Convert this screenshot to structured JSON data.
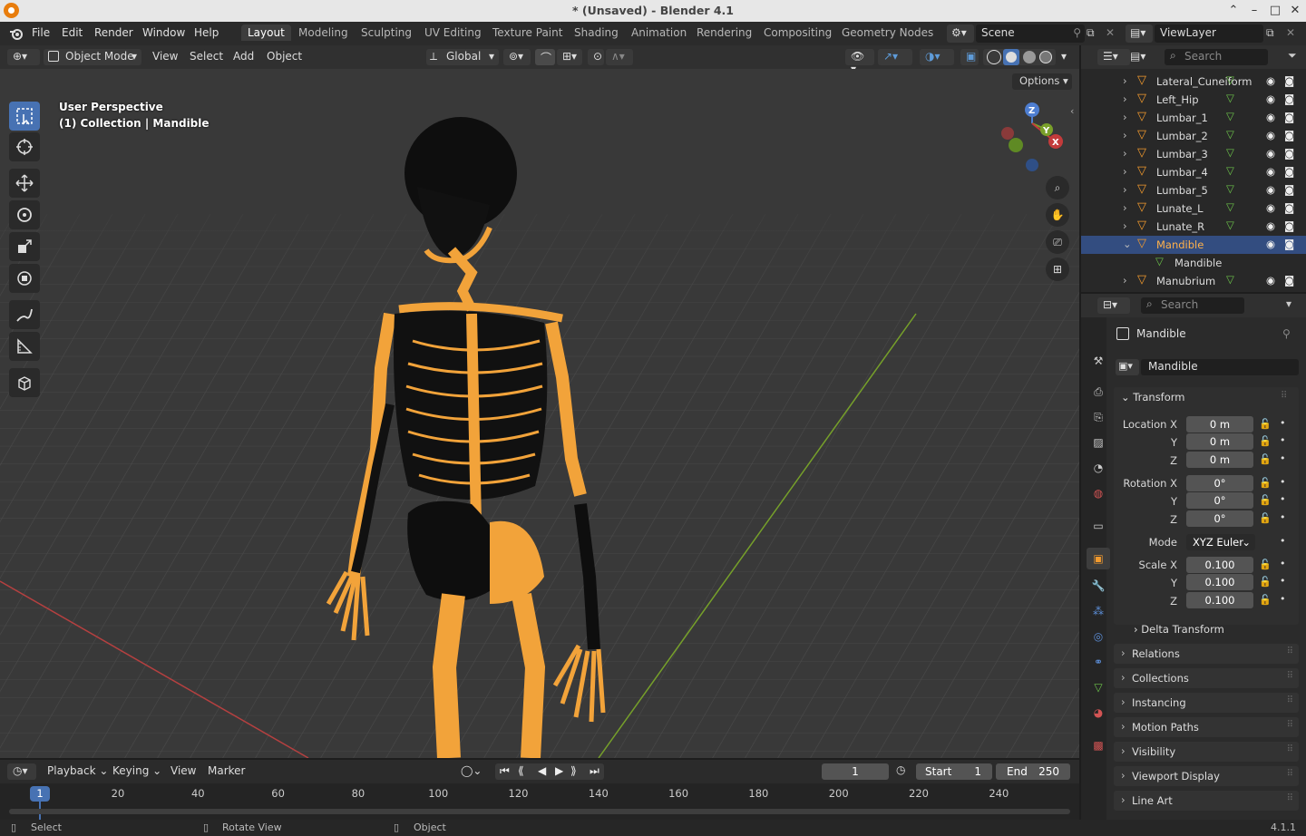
{
  "window": {
    "title": "* (Unsaved) - Blender 4.1"
  },
  "menubar": {
    "items": [
      "File",
      "Edit",
      "Render",
      "Window",
      "Help"
    ]
  },
  "workspaces": {
    "active": "Layout",
    "tabs": [
      "Layout",
      "Modeling",
      "Sculpting",
      "UV Editing",
      "Texture Paint",
      "Shading",
      "Animation",
      "Rendering",
      "Compositing",
      "Geometry Nodes"
    ]
  },
  "scene": {
    "name": "Scene",
    "view_layer": "ViewLayer"
  },
  "viewport_header": {
    "mode": "Object Mode",
    "menus": [
      "View",
      "Select",
      "Add",
      "Object"
    ],
    "orientation": "Global",
    "options": "Options"
  },
  "viewport": {
    "perspective": "User Perspective",
    "collection_info": "(1) Collection | Mandible",
    "gizmo": {
      "x": "X",
      "y": "Y",
      "z": "Z"
    }
  },
  "outliner": {
    "search_placeholder": "Search",
    "rows": [
      {
        "name": "Lateral_Cuneiform",
        "selected": false
      },
      {
        "name": "Left_Hip",
        "selected": false
      },
      {
        "name": "Lumbar_1",
        "selected": false
      },
      {
        "name": "Lumbar_2",
        "selected": false
      },
      {
        "name": "Lumbar_3",
        "selected": false
      },
      {
        "name": "Lumbar_4",
        "selected": false
      },
      {
        "name": "Lumbar_5",
        "selected": false
      },
      {
        "name": "Lunate_L",
        "selected": false
      },
      {
        "name": "Lunate_R",
        "selected": false
      },
      {
        "name": "Mandible",
        "selected": true
      },
      {
        "name": "Mandible",
        "selected": false,
        "child": true
      },
      {
        "name": "Manubrium",
        "selected": false
      }
    ]
  },
  "properties": {
    "search_placeholder": "Search",
    "object_name": "Mandible",
    "datablock_name": "Mandible",
    "transform": {
      "title": "Transform",
      "location_label": "Location X",
      "rotation_label": "Rotation X",
      "scale_label": "Scale X",
      "y_label": "Y",
      "z_label": "Z",
      "location": [
        "0 m",
        "0 m",
        "0 m"
      ],
      "rotation": [
        "0°",
        "0°",
        "0°"
      ],
      "mode_label": "Mode",
      "mode": "XYZ Euler",
      "scale": [
        "0.100",
        "0.100",
        "0.100"
      ],
      "delta": "Delta Transform"
    },
    "sections": [
      "Relations",
      "Collections",
      "Instancing",
      "Motion Paths",
      "Visibility",
      "Viewport Display",
      "Line Art"
    ]
  },
  "timeline": {
    "menus": [
      "Playback",
      "Keying",
      "View",
      "Marker"
    ],
    "current_frame": "1",
    "start_label": "Start",
    "start": "1",
    "end_label": "End",
    "end": "250",
    "ticks": [
      "20",
      "40",
      "60",
      "80",
      "100",
      "120",
      "140",
      "160",
      "180",
      "200",
      "220",
      "240"
    ],
    "playhead": "1"
  },
  "statusbar": {
    "select": "Select",
    "rotate": "Rotate View",
    "object": "Object",
    "version": "4.1.1"
  },
  "colors": {
    "accent": "#4772b3",
    "selection_orange": "#f5a030",
    "bone_orange": "#f2a33a",
    "axis_x": "#c33b3b",
    "axis_y": "#7aa02a"
  }
}
